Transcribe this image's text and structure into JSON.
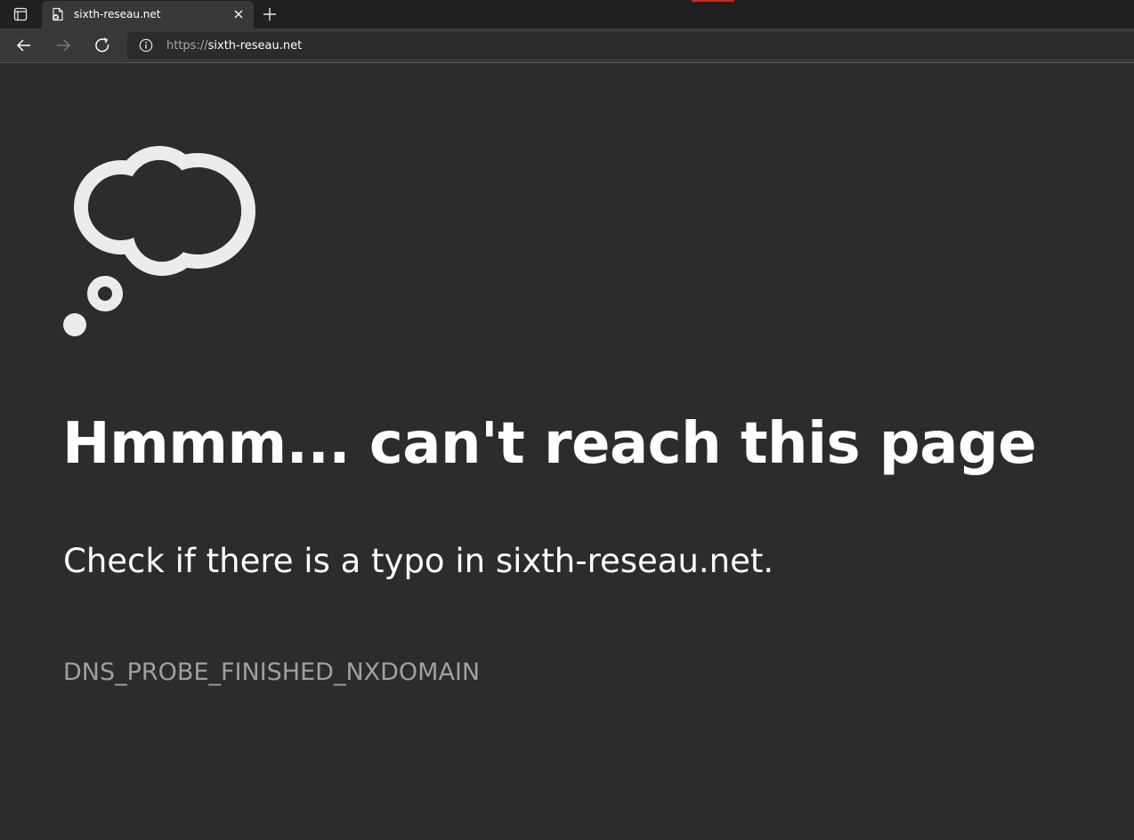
{
  "browser": {
    "tab": {
      "title": "sixth-reseau.net",
      "favicon": "broken-page-icon"
    },
    "new_tab_icon": "plus-icon",
    "nav": {
      "back_icon": "arrow-left-icon",
      "forward_icon": "arrow-right-icon",
      "refresh_icon": "refresh-icon"
    },
    "address_bar": {
      "info_icon": "info-icon",
      "scheme": "https://",
      "host": "sixth-reseau.net"
    },
    "accent_color": "#c42b1c"
  },
  "error_page": {
    "illustration": "thought-cloud-icon",
    "heading": "Hmmm... can't reach this page",
    "message": "Check if there is a typo in sixth-reseau.net.",
    "error_code": "DNS_PROBE_FINISHED_NXDOMAIN",
    "background_color": "#2c2c2c",
    "text_color": "#ffffff",
    "code_color": "#a0a0a0"
  }
}
